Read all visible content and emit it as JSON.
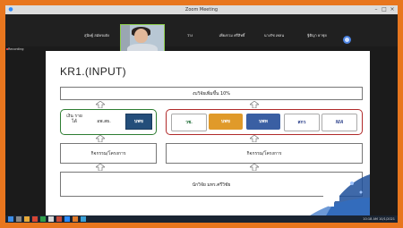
{
  "window": {
    "title": "Zoom Meeting"
  },
  "participants": [
    {
      "name": "สุนิษฐ์ สมัครผลัง"
    },
    {
      "name": "ว่าง"
    },
    {
      "name": "เพียงรวม ศรีสิทธิ์"
    },
    {
      "name": "นางรัช เทลน"
    },
    {
      "name": "ฐิติญา ยาชุย"
    }
  ],
  "camera": {
    "name": "Tasaniya"
  },
  "sidebar": {
    "label": "Recording"
  },
  "slide": {
    "title": "KR1.(INPUT)",
    "top_bar": "งบวิจัยเพิ่มขึ้น 10%",
    "left_group": {
      "item1": "เงิน รายได้",
      "item2": "อพ.สธ."
    },
    "logos": [
      "วช.",
      "บพข",
      "บพท",
      "สกว",
      "NIA"
    ],
    "left_activity": "กิจกรรม/โครงการ",
    "right_activity": "กิจกรรม/โครงการ",
    "bottom_bar": "นักวิจัย มทร.ศรีวิชัย"
  },
  "colors": {
    "frame": "#e8761e",
    "green_border": "#2e7d32",
    "red_border": "#b02a2a"
  },
  "taskbar": {
    "time": "10:18 AM",
    "date": "10/1/2021"
  }
}
